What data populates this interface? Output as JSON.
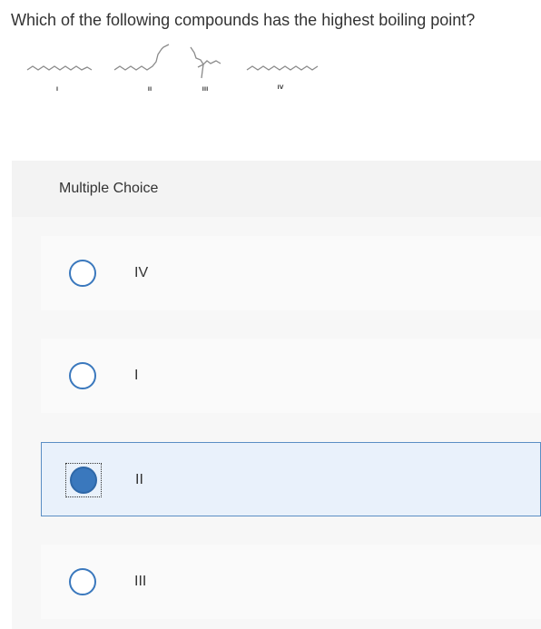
{
  "question": {
    "text": "Which of the following compounds has the highest boiling point?"
  },
  "structures": [
    {
      "label": "I"
    },
    {
      "label": "II"
    },
    {
      "label": "III"
    },
    {
      "label": "IV"
    }
  ],
  "multiple_choice": {
    "title": "Multiple Choice",
    "selected_index": 2,
    "options": [
      {
        "label": "IV",
        "selected": false
      },
      {
        "label": "I",
        "selected": false
      },
      {
        "label": "II",
        "selected": true
      },
      {
        "label": "III",
        "selected": false
      }
    ]
  },
  "colors": {
    "accent": "#3a78bd",
    "selected_background": "#e9f1fb",
    "panel_background": "#f3f3f3"
  }
}
